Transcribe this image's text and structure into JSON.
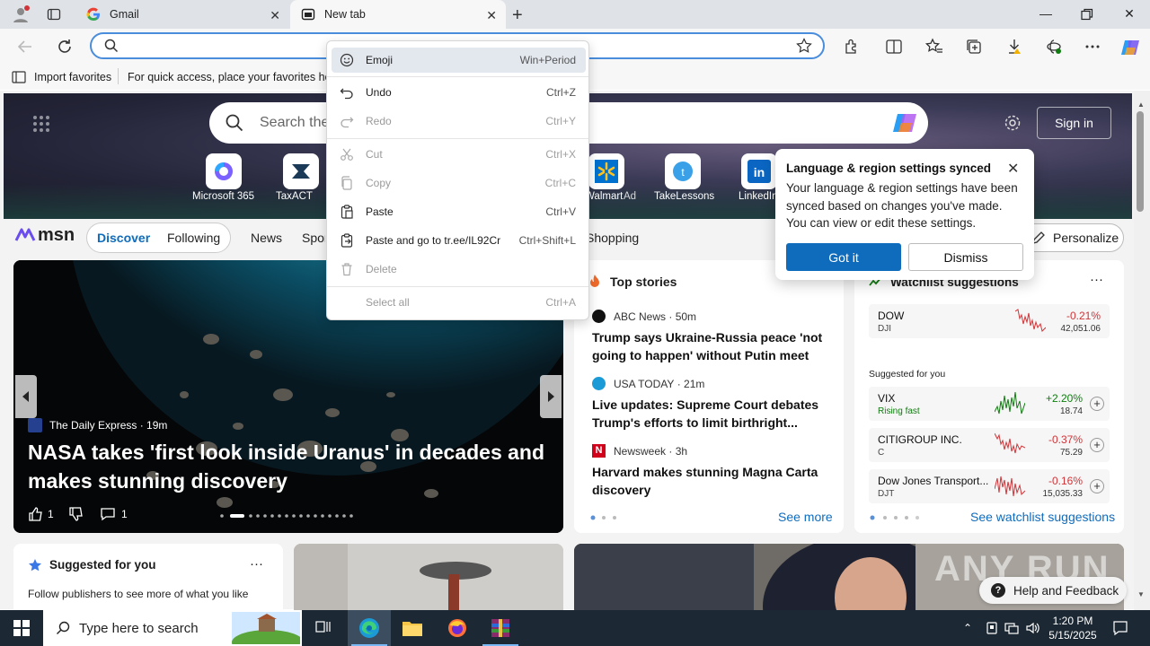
{
  "browser": {
    "tabs": [
      {
        "label": "Gmail",
        "icon": "google-icon"
      },
      {
        "label": "New tab",
        "icon": "newtab-icon"
      }
    ],
    "address_value": "",
    "favorites_bar": {
      "import_label": "Import favorites",
      "hint": "For quick access, place your favorites here on the favorites bar."
    }
  },
  "context_menu": {
    "items": [
      {
        "label": "Emoji",
        "shortcut": "Win+Period",
        "enabled": true,
        "highlighted": true
      },
      {
        "label": "Undo",
        "shortcut": "Ctrl+Z",
        "enabled": true
      },
      {
        "label": "Redo",
        "shortcut": "Ctrl+Y",
        "enabled": false
      },
      {
        "label": "Cut",
        "shortcut": "Ctrl+X",
        "enabled": false
      },
      {
        "label": "Copy",
        "shortcut": "Ctrl+C",
        "enabled": false
      },
      {
        "label": "Paste",
        "shortcut": "Ctrl+V",
        "enabled": true
      },
      {
        "label": "Paste and go to tr.ee/IL92Cr",
        "shortcut": "Ctrl+Shift+L",
        "enabled": true
      },
      {
        "label": "Delete",
        "shortcut": "",
        "enabled": false
      },
      {
        "label": "Select all",
        "shortcut": "Ctrl+A",
        "enabled": false
      }
    ]
  },
  "newtab": {
    "search_placeholder": "Search the web",
    "sign_in": "Sign in",
    "quick_links": [
      "Microsoft 365",
      "TaxACT",
      "Walmart",
      "TakeLessons",
      "LinkedIn"
    ],
    "ad_label": "Ad",
    "msn_logo": "msn",
    "nav": {
      "discover": "Discover",
      "following": "Following",
      "news": "News",
      "sports": "Sports",
      "shopping": "Shopping",
      "personalize": "Personalize"
    },
    "hero_story": {
      "source": "The Daily Express",
      "age": "19m",
      "title": "NASA takes 'first look inside Uranus' in decades and makes stunning discovery",
      "likes": "1",
      "comments": "1"
    },
    "top_stories": {
      "heading": "Top stories",
      "items": [
        {
          "source": "ABC News",
          "age": "50m",
          "title": "Trump says Ukraine-Russia peace 'not going to happen' without Putin meet"
        },
        {
          "source": "USA TODAY",
          "age": "21m",
          "title": "Live updates: Supreme Court debates Trump's efforts to limit birthright..."
        },
        {
          "source": "Newsweek",
          "age": "3h",
          "title": "Harvard makes stunning Magna Carta discovery"
        }
      ],
      "see_more": "See more"
    },
    "watchlist": {
      "heading": "Watchlist suggestions",
      "top": {
        "name": "DOW",
        "ticker": "DJI",
        "change": "-0.21%",
        "price": "42,051.06"
      },
      "suggested_label": "Suggested for you",
      "items": [
        {
          "name": "VIX",
          "ticker": "Rising fast",
          "change": "+2.20%",
          "price": "18.74",
          "up": true
        },
        {
          "name": "CITIGROUP INC.",
          "ticker": "C",
          "change": "-0.37%",
          "price": "75.29",
          "up": false
        },
        {
          "name": "Dow Jones Transport...",
          "ticker": "DJT",
          "change": "-0.16%",
          "price": "15,035.33",
          "up": false
        }
      ],
      "see_all": "See watchlist suggestions"
    },
    "suggested": {
      "heading": "Suggested for you",
      "body": "Follow publishers to see more of what you like"
    },
    "help": "Help and Feedback"
  },
  "popup": {
    "title": "Language & region settings synced",
    "body": "Your language & region settings have been synced based on changes you've made. You can view or edit these settings.",
    "primary": "Got it",
    "secondary": "Dismiss"
  },
  "taskbar": {
    "search_placeholder": "Type here to search",
    "time": "1:20 PM",
    "date": "5/15/2025"
  },
  "colors": {
    "accent": "#0f6cbd",
    "address_focus": "#4a8ddc",
    "stock_up": "#107c10",
    "stock_down": "#d13438",
    "taskbar": "#1c2833"
  }
}
